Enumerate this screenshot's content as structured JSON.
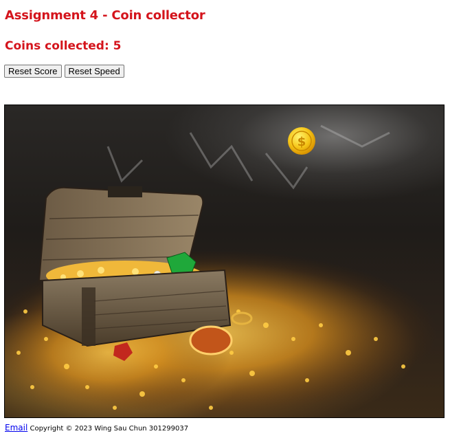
{
  "header": {
    "title": "Assignment 4 - Coin collector",
    "score_label": "Coins collected: 5"
  },
  "controls": {
    "reset_score_label": "Reset Score",
    "reset_speed_label": "Reset Speed"
  },
  "game": {
    "coin_symbol": "$",
    "coin_icon": "dollar-coin-icon",
    "background": "treasure chest in cave"
  },
  "footer": {
    "email_link": "Email",
    "copyright": "Copyright © 2023 Wing Sau Chun 301299037"
  },
  "colors": {
    "title_red": "#d4141c",
    "coin_gold": "#f5c518",
    "link_blue": "#0000ee"
  }
}
